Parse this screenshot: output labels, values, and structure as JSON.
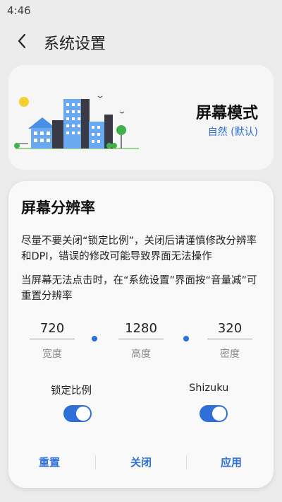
{
  "status_bar": {
    "time": "4:46"
  },
  "header": {
    "title": "系统设置"
  },
  "mode_card": {
    "title": "屏幕模式",
    "subtitle": "自然 (默认)"
  },
  "dialog": {
    "title": "屏幕分辨率",
    "paragraph1": "尽量不要关闭“锁定比例”，关闭后请谨慎修改分辨率和DPI，错误的修改可能导致界面无法操作",
    "paragraph2": "当屏幕无法点击时，在“系统设置”界面按“音量减”可重置分辨率",
    "fields": {
      "width": {
        "value": "720",
        "label": "宽度"
      },
      "height": {
        "value": "1280",
        "label": "高度"
      },
      "density": {
        "value": "320",
        "label": "密度"
      }
    },
    "toggles": {
      "lock_ratio": {
        "label": "锁定比例",
        "on": true
      },
      "shizuku": {
        "label": "Shizuku",
        "on": true
      }
    },
    "buttons": {
      "reset": "重置",
      "close": "关闭",
      "apply": "应用"
    }
  },
  "colors": {
    "accent": "#2e6fd8",
    "background": "#ececec",
    "card": "#f6f6f6"
  }
}
